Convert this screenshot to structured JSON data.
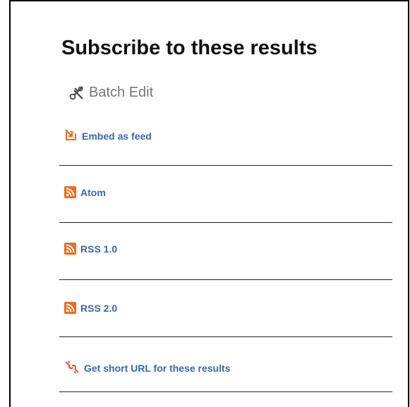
{
  "panel": {
    "title": "Subscribe to these results",
    "batch_edit_label": "Batch Edit",
    "links": [
      {
        "icon": "embed-feed-icon",
        "label": "Embed as feed"
      },
      {
        "icon": "rss-icon",
        "label": "Atom"
      },
      {
        "icon": "rss-icon",
        "label": "RSS 1.0"
      },
      {
        "icon": "rss-icon",
        "label": "RSS 2.0"
      },
      {
        "icon": "short-url-icon",
        "label": "Get short URL for these results"
      }
    ]
  },
  "colors": {
    "link": "#3b66b0",
    "feed_orange": "#f26a1b",
    "title": "#111111",
    "muted": "#777777"
  }
}
